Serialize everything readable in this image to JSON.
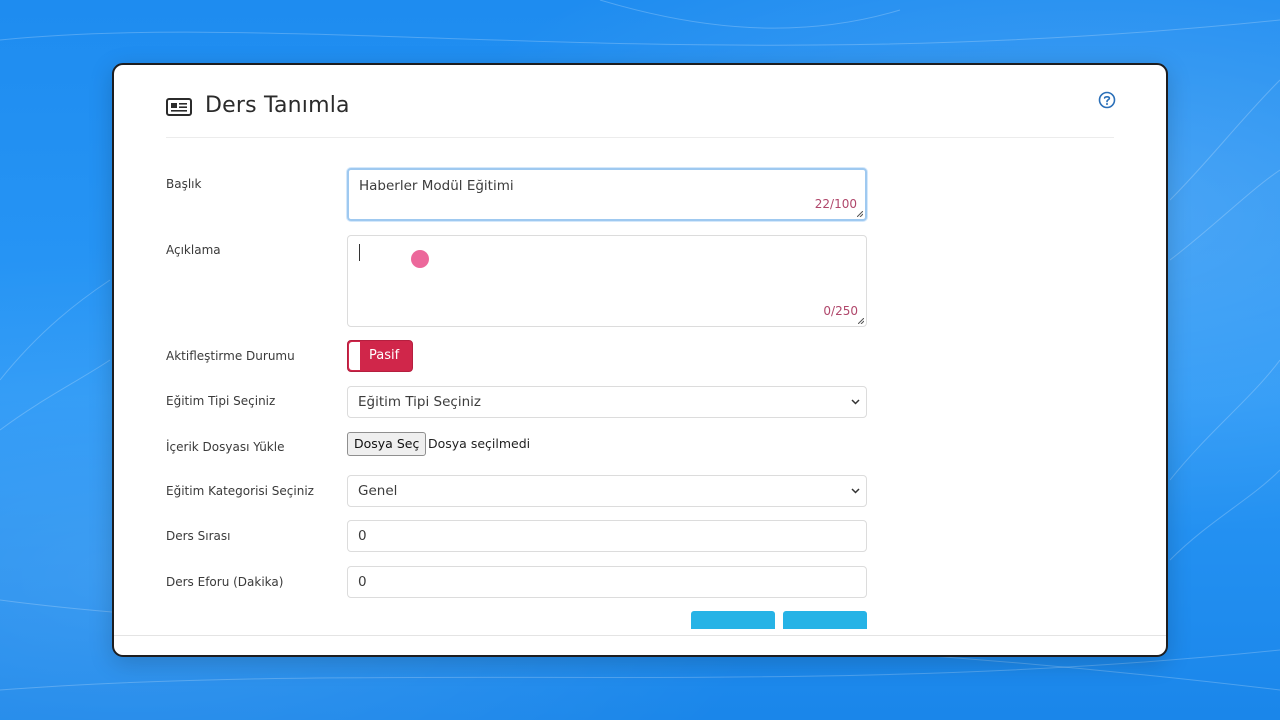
{
  "form": {
    "title": "Ders Tanımla",
    "title_icon": "newspaper-icon",
    "help_icon": "question-circle-icon",
    "baslik": {
      "label": "Başlık",
      "value": "Haberler Modül Eğitimi",
      "counter": "22/100"
    },
    "aciklama": {
      "label": "Açıklama",
      "value": "",
      "counter": "0/250"
    },
    "aktif": {
      "label": "Aktifleştirme Durumu",
      "toggle_text": "Pasif"
    },
    "egitim_tipi": {
      "label": "Eğitim Tipi Seçiniz",
      "selected": "Eğitim Tipi Seçiniz"
    },
    "icerik": {
      "label": "İçerik Dosyası Yükle",
      "button": "Dosya Seç",
      "status": "Dosya seçilmedi"
    },
    "kategori": {
      "label": "Eğitim Kategorisi Seçiniz",
      "selected": "Genel"
    },
    "ders_sirasi": {
      "label": "Ders Sırası",
      "value": "0"
    },
    "ders_eforu": {
      "label": "Ders Eforu (Dakika)",
      "value": "0"
    }
  },
  "colors": {
    "background": "#1e8cf0",
    "toggle_off": "#d0264a",
    "counter": "#b0476b",
    "action_button": "#26b3e6"
  }
}
